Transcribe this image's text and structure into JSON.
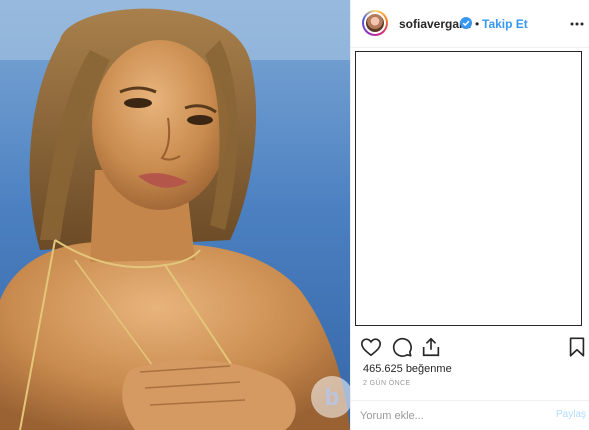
{
  "post": {
    "username": "sofiavergara",
    "separator": "•",
    "follow_label": "Takip Et",
    "likes_text": "465.625 beğenme",
    "time_text": "2 GÜN ÖNCE",
    "comment_placeholder": "Yorum ekle...",
    "post_label": "Paylaş"
  },
  "icons": {
    "verified": "verified-badge-icon",
    "more": "more-options-icon",
    "like": "heart-icon",
    "comment": "comment-icon",
    "share": "share-icon",
    "save": "bookmark-icon",
    "watermark": "b-logo-watermark"
  },
  "colors": {
    "link_blue": "#3897f0",
    "text": "#262626",
    "muted": "#999999",
    "disabled_post": "#b3dbff"
  }
}
